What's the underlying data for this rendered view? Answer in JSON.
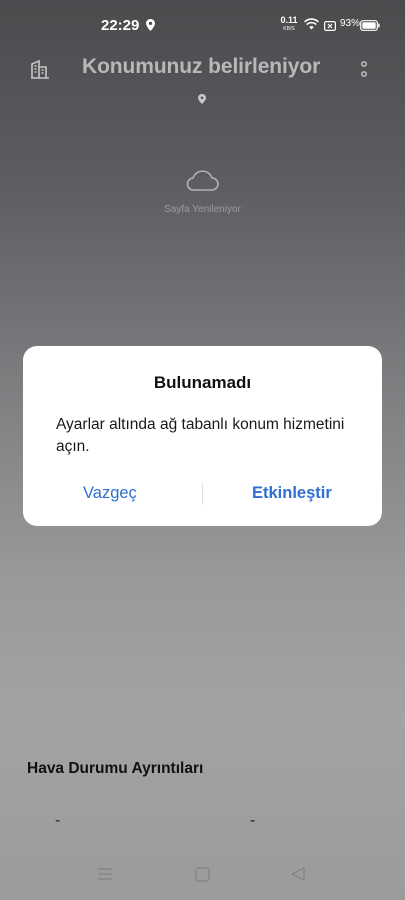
{
  "status_bar": {
    "time": "22:29",
    "net_speed_value": "0.11",
    "net_speed_unit": "KB/S",
    "battery_percent": "93%"
  },
  "header": {
    "title": "Konumunuz belirleniyor"
  },
  "loading": {
    "text": "Sayfa Yenileniyor"
  },
  "dialog": {
    "title": "Bulunamadı",
    "message": "Ayarlar altında ağ tabanlı konum hizmetini açın.",
    "cancel_label": "Vazgeç",
    "enable_label": "Etkinleştir"
  },
  "details": {
    "title": "Hava Durumu Ayrıntıları",
    "value_left": "-",
    "value_right": "-"
  },
  "colors": {
    "accent": "#2f6fd1",
    "dialog_bg": "#ffffff"
  },
  "icons": [
    "location-pin-icon",
    "wifi-icon",
    "sim-icon",
    "battery-icon",
    "building-icon",
    "more-vertical-icon",
    "cloud-icon",
    "menu-icon",
    "home-icon",
    "back-icon"
  ]
}
